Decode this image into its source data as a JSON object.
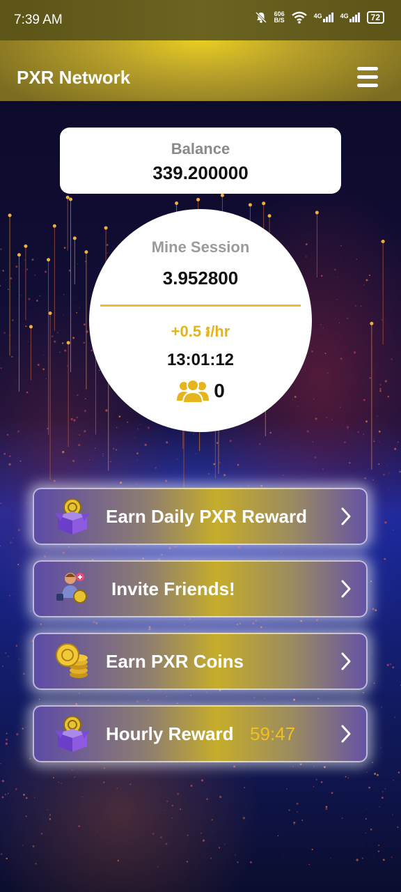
{
  "status": {
    "time": "7:39 AM",
    "net_speed_value": "606",
    "net_speed_unit": "B/S",
    "sig1": "4G",
    "sig2": "4G",
    "battery": "72"
  },
  "header": {
    "title": "PXR Network",
    "menu_icon": "hamburger-menu-icon"
  },
  "balance": {
    "label": "Balance",
    "value": "339.200000"
  },
  "mine": {
    "label": "Mine Session",
    "value": "3.952800",
    "rate": "+0.5 ៛/hr",
    "timer": "13:01:12",
    "team_count": "0"
  },
  "actions": [
    {
      "label": "Earn Daily PXR Reward",
      "icon": "gift-box-icon"
    },
    {
      "label": "Invite Friends!",
      "icon": "invite-user-icon"
    },
    {
      "label": "Earn PXR Coins",
      "icon": "coin-stack-icon"
    },
    {
      "label": "Hourly Reward",
      "countdown": "59:47",
      "icon": "gift-box-icon"
    }
  ],
  "colors": {
    "accent": "#e6c22a",
    "header": "#c9b12a",
    "button_purple": "#5c4aa8"
  }
}
